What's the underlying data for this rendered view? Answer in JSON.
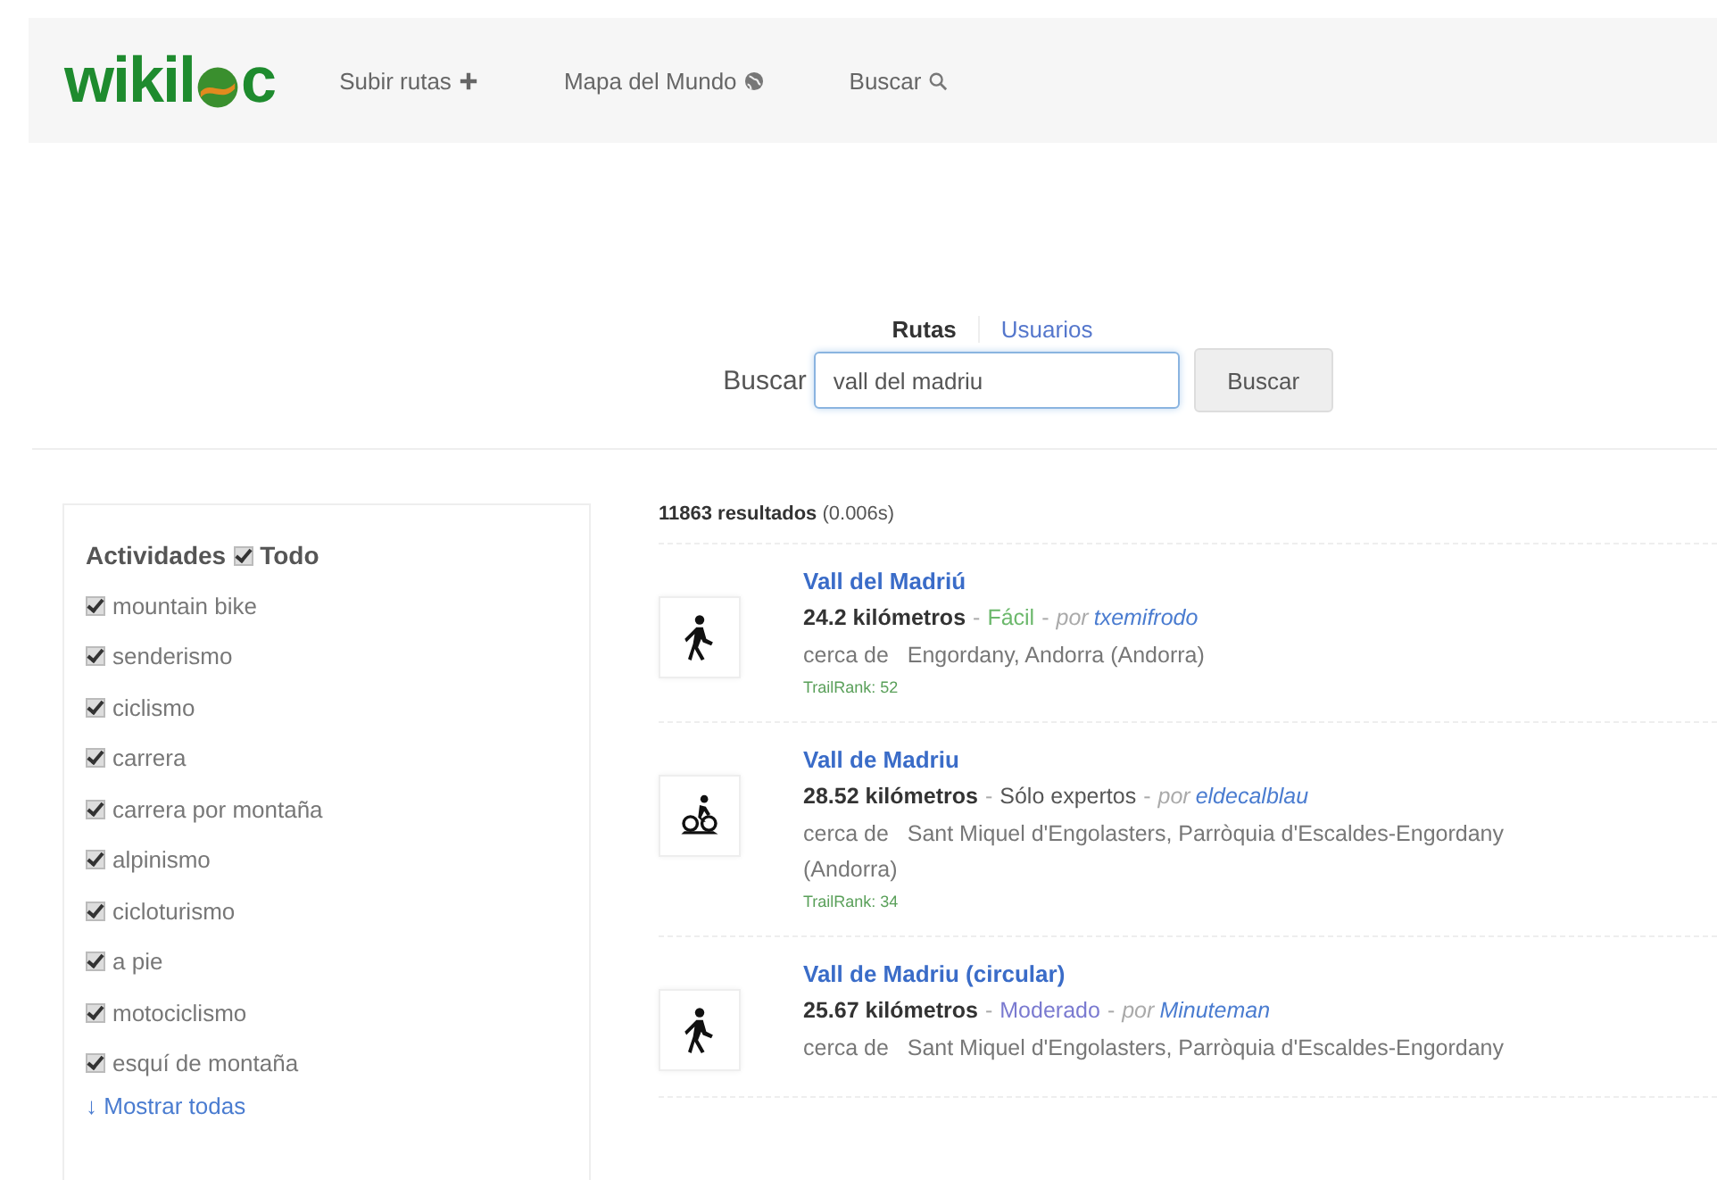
{
  "logo": {
    "before": "wikil",
    "after": "c"
  },
  "nav": [
    {
      "label": "Subir rutas"
    },
    {
      "label": "Mapa del Mundo"
    },
    {
      "label": "Buscar"
    }
  ],
  "search": {
    "tabs": [
      {
        "label": "Rutas",
        "selected": true
      },
      {
        "label": "Usuarios",
        "selected": false
      }
    ],
    "label": "Buscar",
    "value": "vall del madriu",
    "button": "Buscar"
  },
  "filters": {
    "title": "Actividades",
    "all": {
      "label": "Todo",
      "checked": true
    },
    "items": [
      {
        "label": "mountain bike",
        "checked": true
      },
      {
        "label": "senderismo",
        "checked": true
      },
      {
        "label": "ciclismo",
        "checked": true
      },
      {
        "label": "carrera",
        "checked": true
      },
      {
        "label": "carrera por montaña",
        "checked": true
      },
      {
        "label": "alpinismo",
        "checked": true
      },
      {
        "label": "cicloturismo",
        "checked": true
      },
      {
        "label": "a pie",
        "checked": true
      },
      {
        "label": "motociclismo",
        "checked": true
      },
      {
        "label": "esquí de montaña",
        "checked": true
      }
    ],
    "more": "Mostrar todas",
    "more_icon": "↓"
  },
  "results": {
    "count": "11863 resultados",
    "time": "(0.006s)",
    "items": [
      {
        "kind": "hiking",
        "title": "Vall del Madriú",
        "distance": "24.2 kilómetros",
        "sep": "-",
        "difficulty": "Fácil",
        "color": "#6cb86c",
        "sep2": "-",
        "by": "por",
        "author": "txemifrodo",
        "near": "cerca de",
        "location": "Engordany, Andorra (Andorra)",
        "rank": "TrailRank: 52"
      },
      {
        "kind": "mtb",
        "title": "Vall de Madriu",
        "distance": "28.52 kilómetros",
        "sep": "-",
        "difficulty": "Sólo expertos",
        "color": "#555555",
        "sep2": "-",
        "by": "por",
        "author": "eldecalblau",
        "near": "cerca de",
        "location": "Sant Miquel d'Engolasters, Parròquia d'Escaldes-Engordany (Andorra)",
        "rank": "TrailRank: 34"
      },
      {
        "kind": "hiking",
        "title": "Vall de Madriu (circular)",
        "distance": "25.67 kilómetros",
        "sep": "-",
        "difficulty": "Moderado",
        "color": "#7a7ad0",
        "sep2": "-",
        "by": "por",
        "author": "Minuteman",
        "near": "cerca de",
        "location": "Sant Miquel d'Engolasters, Parròquia d'Escaldes-Engordany"
      }
    ]
  }
}
